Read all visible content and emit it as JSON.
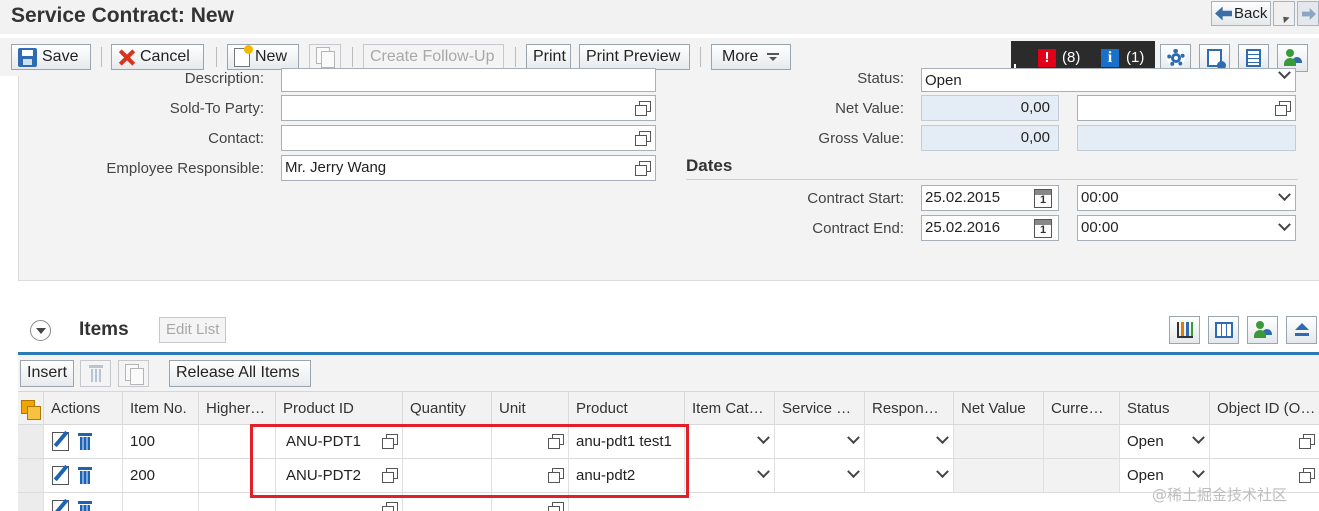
{
  "window": {
    "title": "Service Contract: New",
    "back_label": "Back"
  },
  "toolbar": {
    "save": "Save",
    "cancel": "Cancel",
    "new": "New",
    "create_follow_up": "Create Follow-Up",
    "print": "Print",
    "print_preview": "Print Preview",
    "more": "More"
  },
  "messages": {
    "errors": "(8)",
    "errors_icon": "!",
    "infos": "(1)",
    "infos_icon": "i"
  },
  "form": {
    "description_label": "Description:",
    "description_value": "",
    "sold_to_label": "Sold-To Party:",
    "sold_to_value": "",
    "contact_label": "Contact:",
    "contact_value": "",
    "employee_label": "Employee Responsible:",
    "employee_value": "Mr. Jerry Wang",
    "status_label": "Status:",
    "status_value": "Open",
    "net_value_label": "Net Value:",
    "net_value": "0,00",
    "net_value_currency": "",
    "gross_value_label": "Gross Value:",
    "gross_value": "0,00",
    "gross_value_currency": ""
  },
  "dates": {
    "title": "Dates",
    "contract_start_label": "Contract Start:",
    "contract_start_date": "25.02.2015",
    "contract_start_time": "00:00",
    "contract_end_label": "Contract End:",
    "contract_end_date": "25.02.2016",
    "contract_end_time": "00:00"
  },
  "items": {
    "title": "Items",
    "edit_list": "Edit List",
    "insert": "Insert",
    "release_all": "Release All Items",
    "columns": [
      "Actions",
      "Item No.",
      "Higher…",
      "Product ID",
      "Quantity",
      "Unit",
      "Product",
      "Item Cat…",
      "Service …",
      "Respon…",
      "Net Value",
      "Curre…",
      "Status",
      "Object ID (O…"
    ],
    "rows": [
      {
        "item_no": "100",
        "product_id": "ANU-PDT1",
        "product": "anu-pdt1 test1",
        "status": "Open"
      },
      {
        "item_no": "200",
        "product_id": "ANU-PDT2",
        "product": "anu-pdt2",
        "status": "Open"
      }
    ]
  },
  "watermark": "@稀土掘金技术社区"
}
